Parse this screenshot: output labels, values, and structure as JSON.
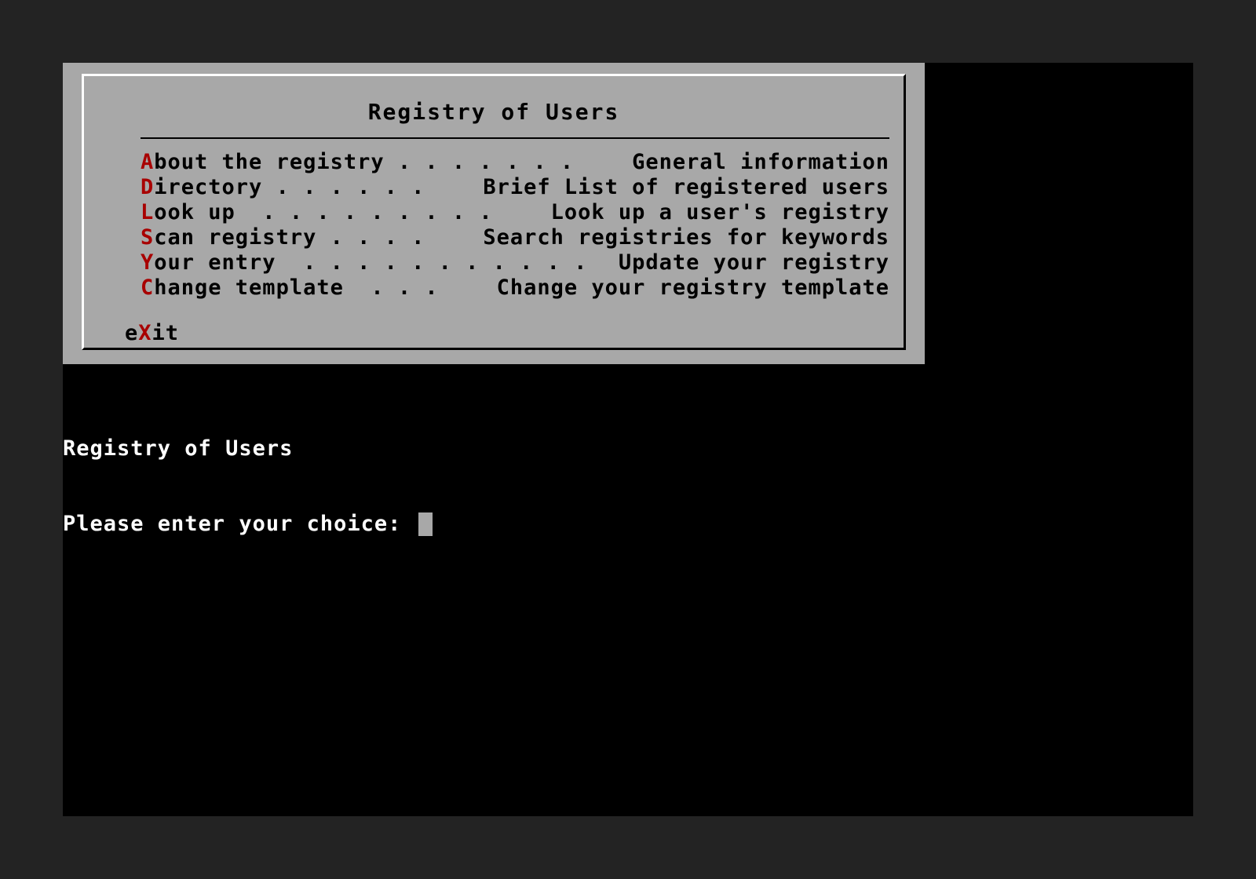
{
  "menu": {
    "title": "Registry of Users",
    "items": [
      {
        "hotkey": "A",
        "rest": "bout the registry . . . . . . .",
        "desc": "General information"
      },
      {
        "hotkey": "D",
        "rest": "irectory . . . . . .",
        "desc": "Brief List of registered users"
      },
      {
        "hotkey": "L",
        "rest": "ook up  . . . . . . . . .",
        "desc": "Look up a user's registry"
      },
      {
        "hotkey": "S",
        "rest": "can registry . . . .",
        "desc": "Search registries for keywords"
      },
      {
        "hotkey": "Y",
        "rest": "our entry  . . . . . . . . . . .",
        "desc": "Update your registry"
      },
      {
        "hotkey": "C",
        "rest": "hange template  . . .",
        "desc": "Change your registry template"
      }
    ],
    "exit": {
      "pre": "e",
      "hotkey": "X",
      "post": "it"
    }
  },
  "console": {
    "line1": "Registry of Users",
    "prompt": "Please enter your choice: "
  },
  "colors": {
    "panel_bg": "#a8a8a8",
    "hotkey": "#a80000",
    "screen_bg": "#000000",
    "console_text": "#ffffff",
    "cursor": "#a8a8a8"
  }
}
